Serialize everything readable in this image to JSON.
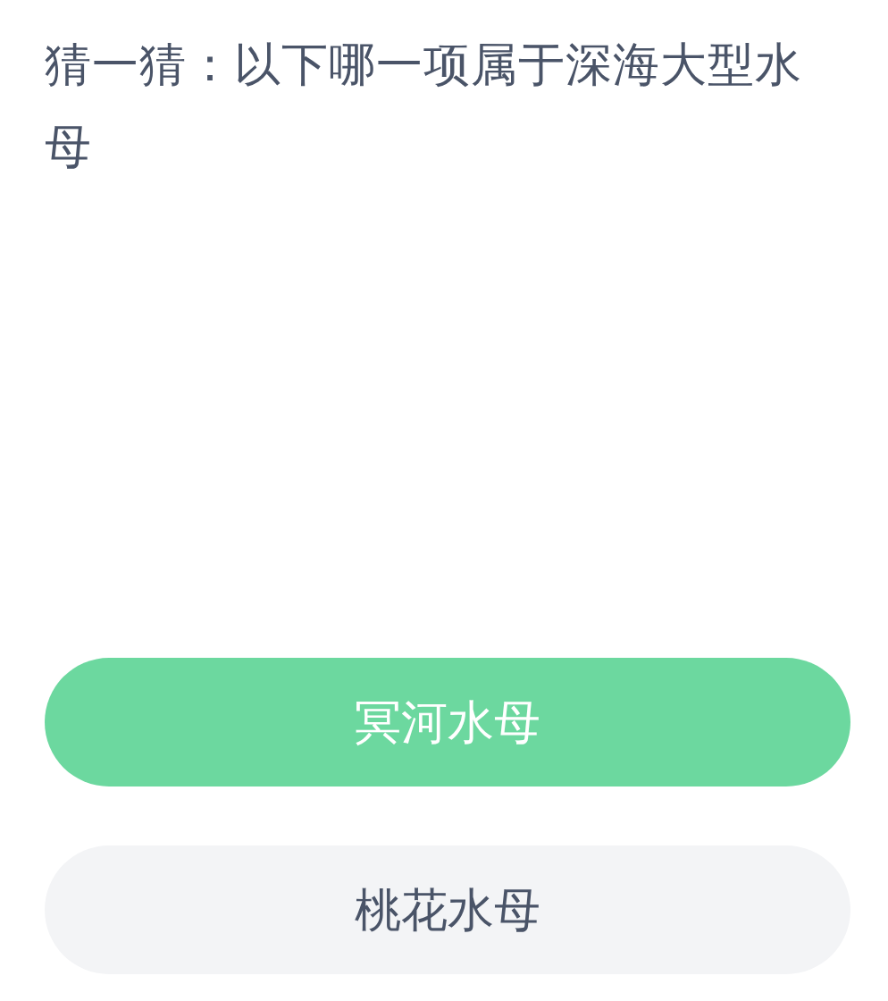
{
  "question": "猜一猜：以下哪一项属于深海大型水母",
  "options": [
    {
      "label": "冥河水母",
      "selected": true
    },
    {
      "label": "桃花水母",
      "selected": false
    }
  ]
}
